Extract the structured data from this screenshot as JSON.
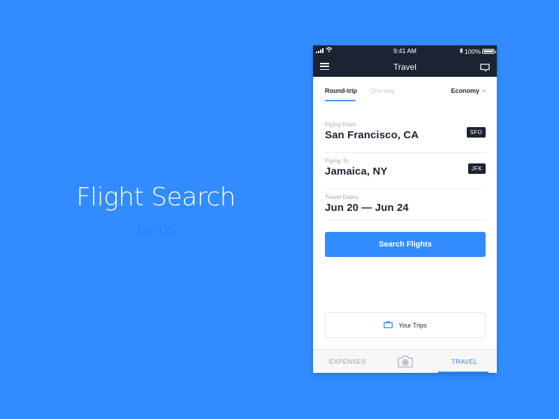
{
  "hero": {
    "title": "Flight Search",
    "subtitle": "for iOS"
  },
  "status_bar": {
    "time": "9:41 AM",
    "battery_label": "100%",
    "battery_level_percent": 100,
    "icons": [
      "signal-icon",
      "wifi-icon",
      "bluetooth-icon",
      "battery-icon"
    ]
  },
  "navbar": {
    "title": "Travel",
    "left_icon": "hamburger-menu-icon",
    "right_icon": "chat-icon"
  },
  "trip_type": {
    "tabs": [
      {
        "label": "Round-trip",
        "active": true
      },
      {
        "label": "One-way",
        "active": false
      }
    ],
    "cabin_class": "Economy"
  },
  "form": {
    "from": {
      "label": "Flying From",
      "value": "San Francisco, CA",
      "code": "SFO"
    },
    "to": {
      "label": "Flying To",
      "value": "Jamaica, NY",
      "code": "JFK"
    },
    "dates": {
      "label": "Travel Dates",
      "value": "Jun 20 — Jun 24"
    },
    "submit_label": "Search Flights"
  },
  "your_trips": {
    "label": "Your Trips",
    "icon": "briefcase-icon"
  },
  "tab_bar": {
    "items": [
      {
        "label": "EXPENSES",
        "active": false
      },
      {
        "label": "",
        "icon": "camera-icon",
        "active": false
      },
      {
        "label": "TRAVEL",
        "active": true
      }
    ]
  },
  "colors": {
    "background": "#338cff",
    "header": "#1c2433",
    "accent": "#338cff",
    "text_primary": "#1c2433",
    "text_muted": "#a2a8b1"
  }
}
